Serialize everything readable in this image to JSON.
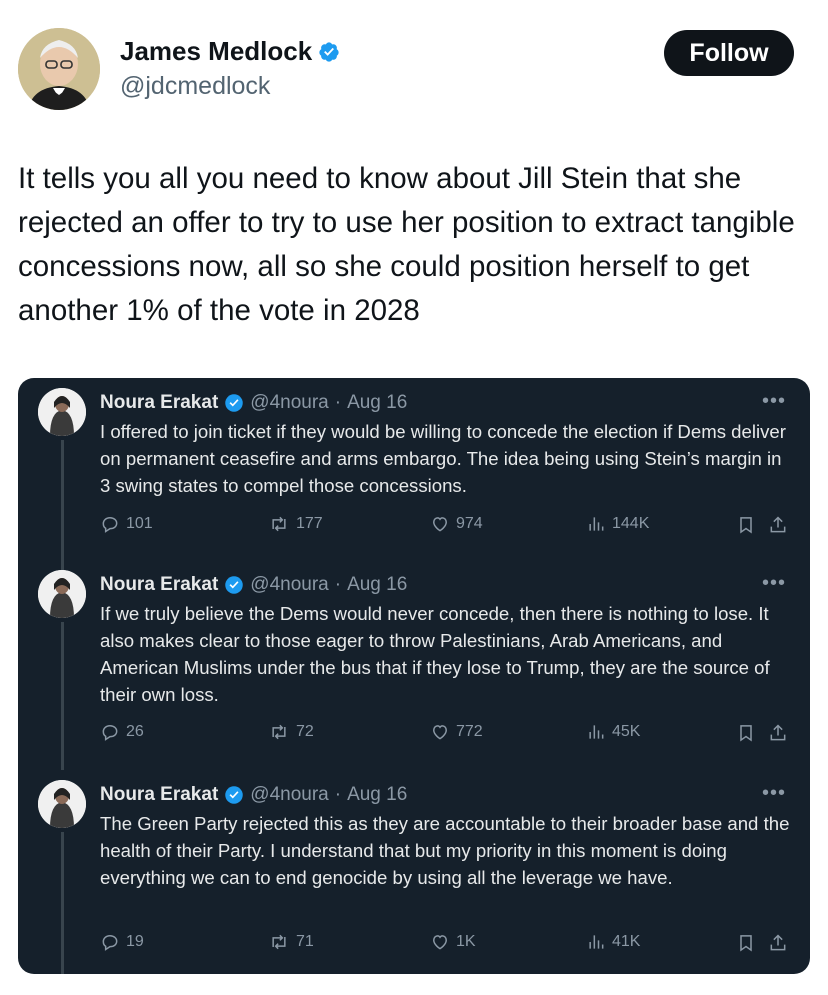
{
  "author": {
    "name": "James Medlock",
    "handle": "@jdcmedlock",
    "follow_label": "Follow"
  },
  "tweet": {
    "text": "It tells you all you need to know about Jill Stein that she rejected an offer to try to use her position to extract tangible concessions now, all so she could position herself to get another 1% of the vote in 2028"
  },
  "quoted_thread": [
    {
      "name": "Noura Erakat",
      "handle": "@4noura",
      "date": "Aug 16",
      "text": "I offered to join ticket if they would be willing to concede the election if Dems deliver on permanent ceasefire and arms embargo. The idea being using Stein’s margin in 3 swing states to compel those concessions.",
      "replies": "101",
      "reposts": "177",
      "likes": "974",
      "views": "144K"
    },
    {
      "name": "Noura Erakat",
      "handle": "@4noura",
      "date": "Aug 16",
      "text": "If we truly believe the Dems would never concede, then there is nothing to lose. It also makes clear to those eager to throw Palestinians, Arab Americans, and American Muslims under the bus that if they lose to Trump, they are the source of their own loss.",
      "replies": "26",
      "reposts": "72",
      "likes": "772",
      "views": "45K"
    },
    {
      "name": "Noura Erakat",
      "handle": "@4noura",
      "date": "Aug 16",
      "text": "The Green Party rejected this as they are accountable to their broader base and the health of their Party. I understand that but my priority in this moment is doing everything we can to end genocide by using all the leverage we have.",
      "replies": "19",
      "reposts": "71",
      "likes": "1K",
      "views": "41K"
    }
  ],
  "colors": {
    "verified": "#1d9bf0",
    "card_bg": "#15202b",
    "muted": "#8b98a5"
  },
  "icons": [
    "verified-badge-icon",
    "reply-icon",
    "repost-icon",
    "like-icon",
    "views-icon",
    "bookmark-icon",
    "share-icon",
    "more-icon"
  ]
}
